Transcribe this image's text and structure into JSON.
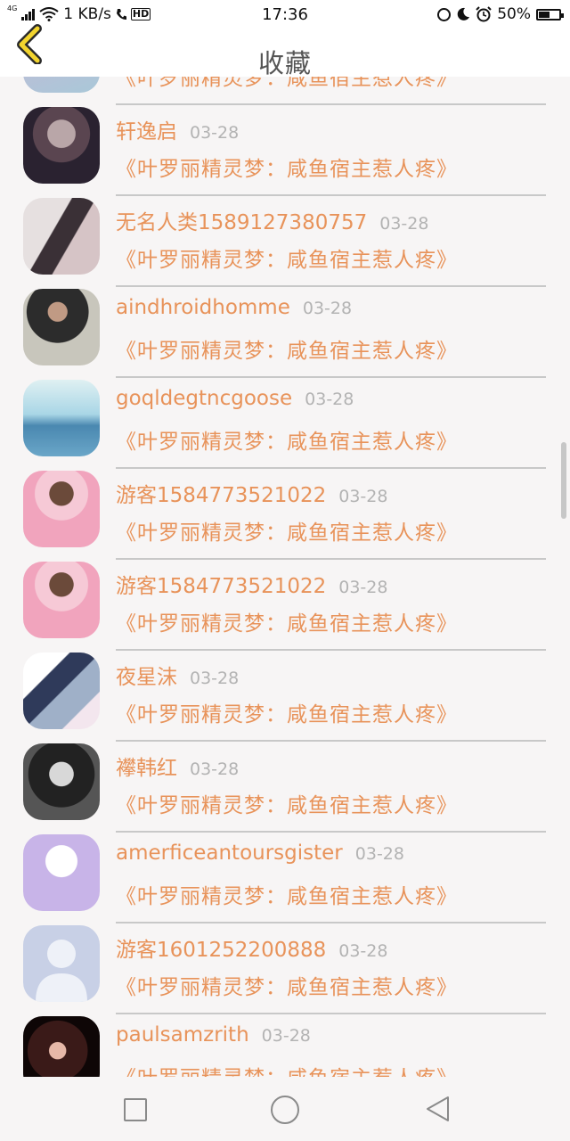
{
  "status_bar": {
    "network_tag": "4G",
    "speed": "1 KB/s",
    "hd": "HD",
    "time": "17:36",
    "battery": "50%",
    "battery_level": 0.5
  },
  "header": {
    "title": "收藏",
    "back_icon": "chevron-left-icon"
  },
  "colors": {
    "accent": "#e8935a",
    "date": "#b3b3b3",
    "divider": "#c8c8c8"
  },
  "items": [
    {
      "user": "",
      "date": "",
      "book": "《叶罗丽精灵梦：咸鱼宿主惹人疼》"
    },
    {
      "user": "轩逸启",
      "date": "03-28",
      "book": "《叶罗丽精灵梦：咸鱼宿主惹人疼》"
    },
    {
      "user": "无名人类1589127380757",
      "date": "03-28",
      "book": "《叶罗丽精灵梦：咸鱼宿主惹人疼》"
    },
    {
      "user": "aindhroidhomme",
      "date": "03-28",
      "book": "《叶罗丽精灵梦：咸鱼宿主惹人疼》"
    },
    {
      "user": "goqldegtncgoose",
      "date": "03-28",
      "book": "《叶罗丽精灵梦：咸鱼宿主惹人疼》"
    },
    {
      "user": "游客1584773521022",
      "date": "03-28",
      "book": "《叶罗丽精灵梦：咸鱼宿主惹人疼》"
    },
    {
      "user": "游客1584773521022",
      "date": "03-28",
      "book": "《叶罗丽精灵梦：咸鱼宿主惹人疼》"
    },
    {
      "user": "夜星沫",
      "date": "03-28",
      "book": "《叶罗丽精灵梦：咸鱼宿主惹人疼》"
    },
    {
      "user": "襻韩红",
      "date": "03-28",
      "book": "《叶罗丽精灵梦：咸鱼宿主惹人疼》"
    },
    {
      "user": "amerficeantoursgister",
      "date": "03-28",
      "book": "《叶罗丽精灵梦：咸鱼宿主惹人疼》"
    },
    {
      "user": "游客1601252200888",
      "date": "03-28",
      "book": "《叶罗丽精灵梦：咸鱼宿主惹人疼》"
    },
    {
      "user": "paulsamzrith",
      "date": "03-28",
      "book": "《叶罗丽精灵梦：咸鱼宿主惹人疼》"
    }
  ],
  "nav_bar": {
    "recents_icon": "square-icon",
    "home_icon": "circle-icon",
    "back_icon": "triangle-back-icon"
  }
}
